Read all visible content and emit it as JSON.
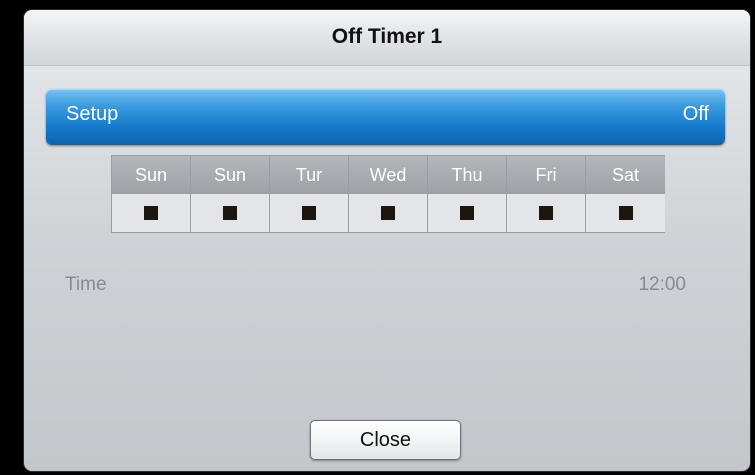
{
  "dialog": {
    "title": "Off Timer 1"
  },
  "setup": {
    "label": "Setup",
    "value": "Off"
  },
  "days": [
    {
      "label": "Sun",
      "checked": false
    },
    {
      "label": "Sun",
      "checked": false
    },
    {
      "label": "Tur",
      "checked": false
    },
    {
      "label": "Wed",
      "checked": false
    },
    {
      "label": "Thu",
      "checked": false
    },
    {
      "label": "Fri",
      "checked": false
    },
    {
      "label": "Sat",
      "checked": false
    }
  ],
  "time": {
    "label": "Time",
    "value": "12:00"
  },
  "buttons": {
    "close_label": "Close"
  },
  "colors": {
    "accent": "#1478c9",
    "background": "#000000",
    "dialog_bg": "#d2d5d9"
  }
}
